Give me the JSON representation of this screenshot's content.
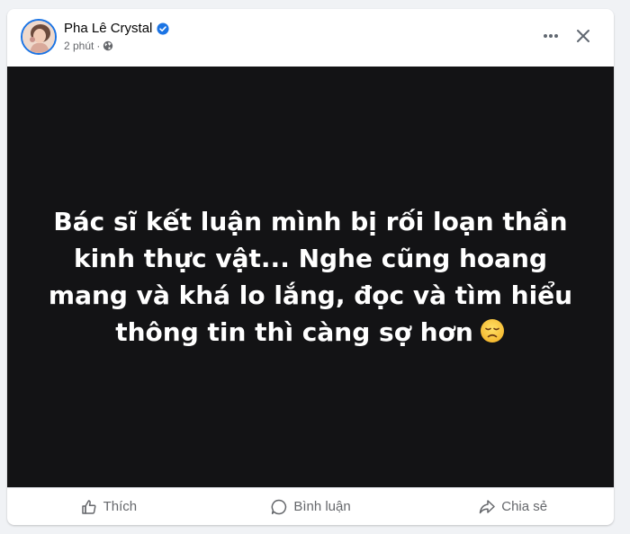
{
  "post": {
    "author": "Pha Lê Crystal",
    "time": "2 phút",
    "separator": "·",
    "text": "Bác sĩ kết luận mình bị rối loạn thần kinh thực vật... Nghe cũng hoang mang và khá lo lắng, đọc và tìm hiểu thông tin thì càng sợ hơn"
  },
  "actions": {
    "like": "Thích",
    "comment": "Bình luận",
    "share": "Chia sẻ"
  },
  "icons": {
    "verified": "verified-badge-icon",
    "privacy": "globe-icon",
    "more": "more-options-icon",
    "close": "close-icon",
    "emoji": "disappointed-face-emoji"
  },
  "colors": {
    "verified": "#1b74e4",
    "image_background": "#131315",
    "action_text": "#65676b"
  }
}
